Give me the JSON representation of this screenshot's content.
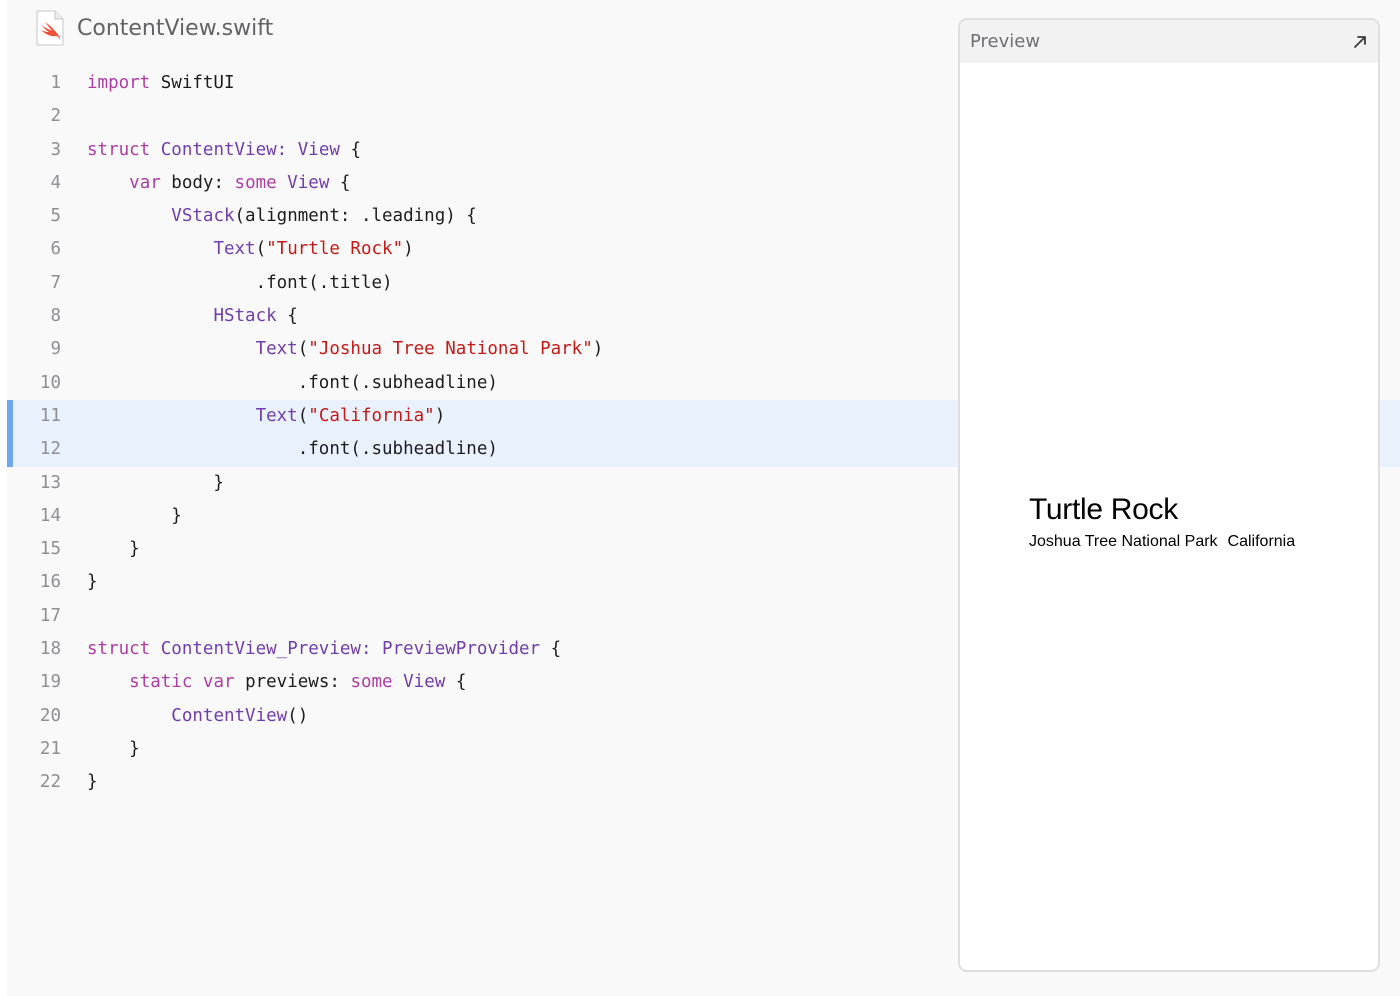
{
  "file": {
    "name": "ContentView.swift",
    "icon": "swift-file-icon"
  },
  "colors": {
    "keyword": "#ad3da4",
    "type": "#703daa",
    "string": "#c41a16",
    "plain": "#1d1d1f",
    "highlight_bg": "#e9f1fd",
    "highlight_bar": "#6ea6ef",
    "swift_orange": "#f05138"
  },
  "highlighted_lines": [
    11,
    12
  ],
  "code_lines": [
    {
      "n": "1",
      "tokens": [
        {
          "t": "import",
          "k": "keyword"
        },
        {
          "t": " SwiftUI",
          "k": "plain"
        }
      ]
    },
    {
      "n": "2",
      "tokens": []
    },
    {
      "n": "3",
      "tokens": [
        {
          "t": "struct",
          "k": "keyword"
        },
        {
          "t": " ",
          "k": "plain"
        },
        {
          "t": "ContentView:",
          "k": "type"
        },
        {
          "t": " ",
          "k": "plain"
        },
        {
          "t": "View",
          "k": "type"
        },
        {
          "t": " {",
          "k": "plain"
        }
      ]
    },
    {
      "n": "4",
      "tokens": [
        {
          "t": "    ",
          "k": "plain"
        },
        {
          "t": "var",
          "k": "keyword"
        },
        {
          "t": " body: ",
          "k": "plain"
        },
        {
          "t": "some",
          "k": "keyword"
        },
        {
          "t": " ",
          "k": "plain"
        },
        {
          "t": "View",
          "k": "type"
        },
        {
          "t": " {",
          "k": "plain"
        }
      ]
    },
    {
      "n": "5",
      "tokens": [
        {
          "t": "        ",
          "k": "plain"
        },
        {
          "t": "VStack",
          "k": "type"
        },
        {
          "t": "(alignment: .leading) {",
          "k": "plain"
        }
      ]
    },
    {
      "n": "6",
      "tokens": [
        {
          "t": "            ",
          "k": "plain"
        },
        {
          "t": "Text",
          "k": "type"
        },
        {
          "t": "(",
          "k": "plain"
        },
        {
          "t": "\"Turtle Rock\"",
          "k": "string"
        },
        {
          "t": ")",
          "k": "plain"
        }
      ]
    },
    {
      "n": "7",
      "tokens": [
        {
          "t": "                .font(.title)",
          "k": "plain"
        }
      ]
    },
    {
      "n": "8",
      "tokens": [
        {
          "t": "            ",
          "k": "plain"
        },
        {
          "t": "HStack",
          "k": "type"
        },
        {
          "t": " {",
          "k": "plain"
        }
      ]
    },
    {
      "n": "9",
      "tokens": [
        {
          "t": "                ",
          "k": "plain"
        },
        {
          "t": "Text",
          "k": "type"
        },
        {
          "t": "(",
          "k": "plain"
        },
        {
          "t": "\"Joshua Tree National Park\"",
          "k": "string"
        },
        {
          "t": ")",
          "k": "plain"
        }
      ]
    },
    {
      "n": "10",
      "tokens": [
        {
          "t": "                    .font(.subheadline)",
          "k": "plain"
        }
      ]
    },
    {
      "n": "11",
      "tokens": [
        {
          "t": "                ",
          "k": "plain"
        },
        {
          "t": "Text",
          "k": "type"
        },
        {
          "t": "(",
          "k": "plain"
        },
        {
          "t": "\"California\"",
          "k": "string"
        },
        {
          "t": ")",
          "k": "plain"
        }
      ]
    },
    {
      "n": "12",
      "tokens": [
        {
          "t": "                    .font(.subheadline)",
          "k": "plain"
        }
      ]
    },
    {
      "n": "13",
      "tokens": [
        {
          "t": "            }",
          "k": "plain"
        }
      ]
    },
    {
      "n": "14",
      "tokens": [
        {
          "t": "        }",
          "k": "plain"
        }
      ]
    },
    {
      "n": "15",
      "tokens": [
        {
          "t": "    }",
          "k": "plain"
        }
      ]
    },
    {
      "n": "16",
      "tokens": [
        {
          "t": "}",
          "k": "plain"
        }
      ]
    },
    {
      "n": "17",
      "tokens": []
    },
    {
      "n": "18",
      "tokens": [
        {
          "t": "struct",
          "k": "keyword"
        },
        {
          "t": " ",
          "k": "plain"
        },
        {
          "t": "ContentView_Preview:",
          "k": "type"
        },
        {
          "t": " ",
          "k": "plain"
        },
        {
          "t": "PreviewProvider",
          "k": "type"
        },
        {
          "t": " {",
          "k": "plain"
        }
      ]
    },
    {
      "n": "19",
      "tokens": [
        {
          "t": "    ",
          "k": "plain"
        },
        {
          "t": "static",
          "k": "keyword"
        },
        {
          "t": " ",
          "k": "plain"
        },
        {
          "t": "var",
          "k": "keyword"
        },
        {
          "t": " previews: ",
          "k": "plain"
        },
        {
          "t": "some",
          "k": "keyword"
        },
        {
          "t": " ",
          "k": "plain"
        },
        {
          "t": "View",
          "k": "type"
        },
        {
          "t": " {",
          "k": "plain"
        }
      ]
    },
    {
      "n": "20",
      "tokens": [
        {
          "t": "        ",
          "k": "plain"
        },
        {
          "t": "ContentView",
          "k": "type"
        },
        {
          "t": "()",
          "k": "plain"
        }
      ]
    },
    {
      "n": "21",
      "tokens": [
        {
          "t": "    }",
          "k": "plain"
        }
      ]
    },
    {
      "n": "22",
      "tokens": [
        {
          "t": "}",
          "k": "plain"
        }
      ]
    }
  ],
  "preview": {
    "title": "Preview",
    "expand_icon": "expand-arrow-icon",
    "content": {
      "title": "Turtle Rock",
      "park": "Joshua Tree National Park",
      "state": "California"
    }
  }
}
